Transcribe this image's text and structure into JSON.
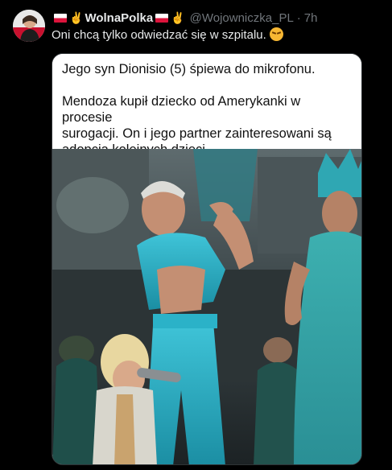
{
  "tweet": {
    "display_name": "WolnaPolka",
    "handle": "@Wojowniczka_PL",
    "separator": "·",
    "time": "7h",
    "text": "Oni chcą tylko odwiedzać się w szpitalu.",
    "avatar_icon": "profile-avatar-icon",
    "flag_icon": "poland-flag-icon",
    "hand_icon": "victory-hand-icon",
    "emoji_icon": "weary-face-icon",
    "hand_glyph": "✌",
    "colors": {
      "background": "#000000",
      "text": "#e7e9ea",
      "muted": "#71767b"
    }
  },
  "media": {
    "caption_line1": "Jego syn Dionisio (5) śpiewa do mikrofonu.",
    "caption_line2a": "Mendoza kupił dziecko od Amerykanki w procesie",
    "caption_line2b": "surogacji. On i jego partner zainteresowani są",
    "caption_line2c": "adopcją kolejnych dzieci."
  }
}
